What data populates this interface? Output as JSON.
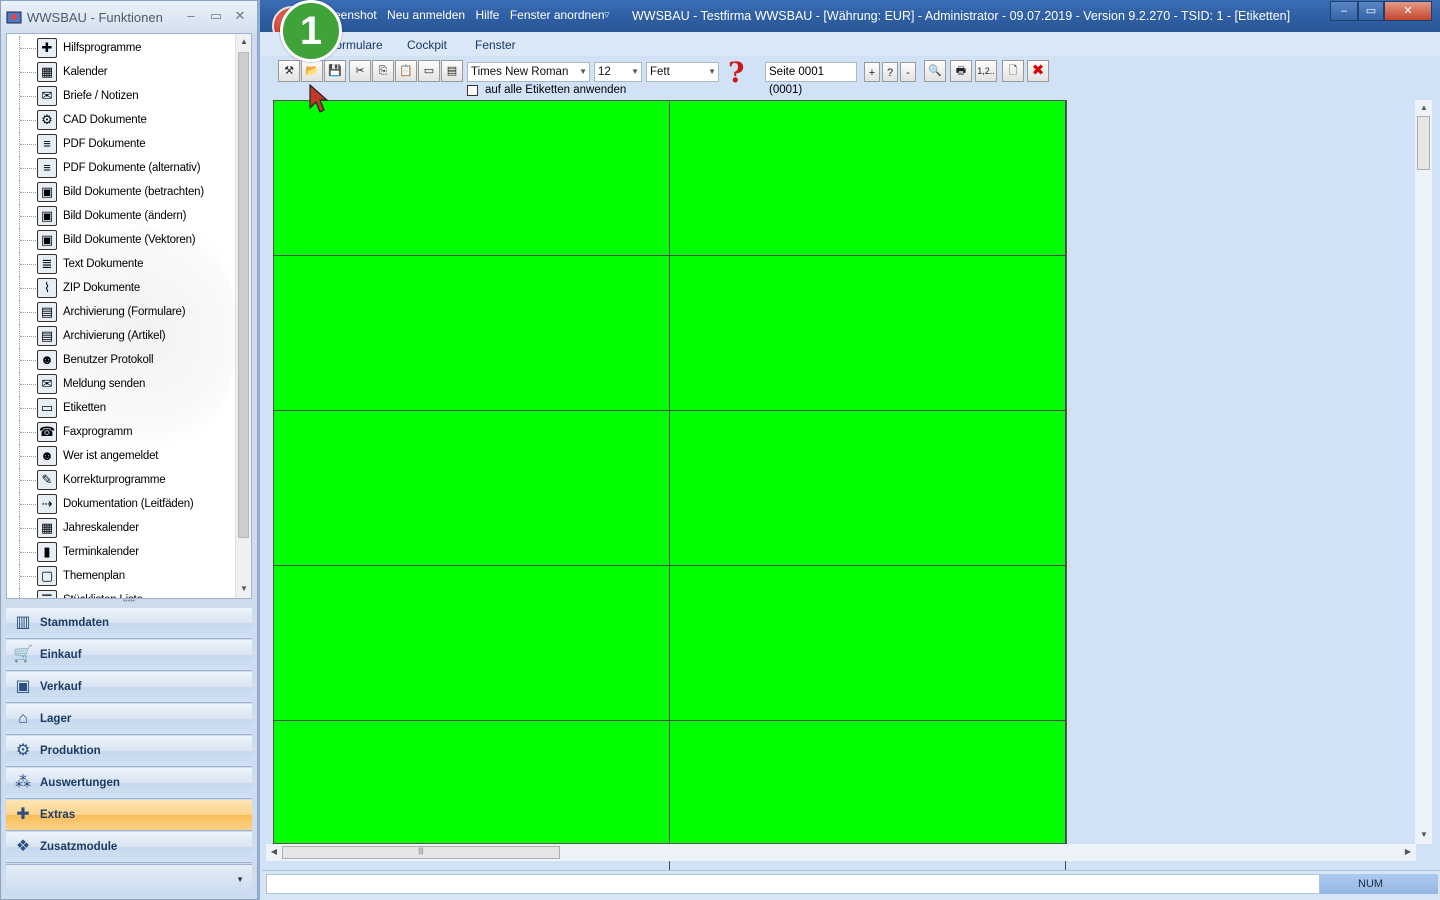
{
  "left_window": {
    "title": "WWSBAU - Funktionen",
    "controls": [
      "–",
      "▭",
      "✕"
    ],
    "tree_items": [
      {
        "label": "Hilfsprogramme",
        "icon": "toolbox-icon"
      },
      {
        "label": "Kalender",
        "icon": "calendar-icon"
      },
      {
        "label": "Briefe / Notizen",
        "icon": "envelope-icon"
      },
      {
        "label": "CAD Dokumente",
        "icon": "cad-icon"
      },
      {
        "label": "PDF Dokumente",
        "icon": "document-icon"
      },
      {
        "label": "PDF Dokumente (alternativ)",
        "icon": "document-icon"
      },
      {
        "label": "Bild Dokumente (betrachten)",
        "icon": "image-icon"
      },
      {
        "label": "Bild Dokumente (ändern)",
        "icon": "image-icon"
      },
      {
        "label": "Bild Dokumente (Vektoren)",
        "icon": "image-icon"
      },
      {
        "label": "Text Dokumente",
        "icon": "text-document-icon"
      },
      {
        "label": "ZIP Dokumente",
        "icon": "zip-icon"
      },
      {
        "label": "Archivierung (Formulare)",
        "icon": "archive-icon"
      },
      {
        "label": "Archivierung (Artikel)",
        "icon": "archive-icon"
      },
      {
        "label": "Benutzer Protokoll",
        "icon": "users-icon"
      },
      {
        "label": "Meldung senden",
        "icon": "send-message-icon"
      },
      {
        "label": "Etiketten",
        "icon": "label-icon"
      },
      {
        "label": "Faxprogramm",
        "icon": "fax-icon"
      },
      {
        "label": "Wer ist angemeldet",
        "icon": "user-globe-icon"
      },
      {
        "label": "Korrekturprogramme",
        "icon": "tools-icon"
      },
      {
        "label": "Dokumentation (Leitfäden)",
        "icon": "signpost-icon"
      },
      {
        "label": "Jahreskalender",
        "icon": "calendar-icon"
      },
      {
        "label": "Terminkalender",
        "icon": "bookmark-icon"
      },
      {
        "label": "Themenplan",
        "icon": "presentation-icon"
      },
      {
        "label": "Stücklisten Liste",
        "icon": "list-icon"
      }
    ],
    "nav_sections": [
      {
        "label": "Stammdaten",
        "icon": "master-data-icon",
        "active": false
      },
      {
        "label": "Einkauf",
        "icon": "cart-icon",
        "active": false
      },
      {
        "label": "Verkauf",
        "icon": "cash-register-icon",
        "active": false
      },
      {
        "label": "Lager",
        "icon": "warehouse-icon",
        "active": false
      },
      {
        "label": "Produktion",
        "icon": "production-icon",
        "active": false
      },
      {
        "label": "Auswertungen",
        "icon": "chart-icon",
        "active": false
      },
      {
        "label": "Extras",
        "icon": "extras-icon",
        "active": true
      },
      {
        "label": "Zusatzmodule",
        "icon": "modules-icon",
        "active": false
      }
    ]
  },
  "main_window": {
    "quick_access": [
      "Screenshot",
      "Neu anmelden",
      "Hilfe",
      "Fenster anordnen"
    ],
    "title": "WWSBAU - Testfirma WWSBAU - [Währung: EUR] - Administrator - 09.07.2019 - Version 9.2.270 - TSID: 1 - [Etiketten]",
    "ribbon_tabs": [
      "Formulare",
      "Cockpit",
      "Fenster"
    ],
    "toolbar": {
      "font_name": "Times New Roman",
      "font_size": "12",
      "font_style": "Fett",
      "help": "?",
      "page_field": "Seite 0001 (0001)",
      "page_plus": "+",
      "page_question": "?",
      "page_minus": "-",
      "numbering": "1,2..",
      "apply_all_label": "auf alle Etiketten anwenden",
      "apply_all_checked": false
    },
    "label_sheet": {
      "columns": 2,
      "rows": 5,
      "color": "#00ff00"
    },
    "status": {
      "num": "NUM"
    }
  },
  "annotation": {
    "badge_number": "1",
    "badge_color": "#3fa33a"
  }
}
